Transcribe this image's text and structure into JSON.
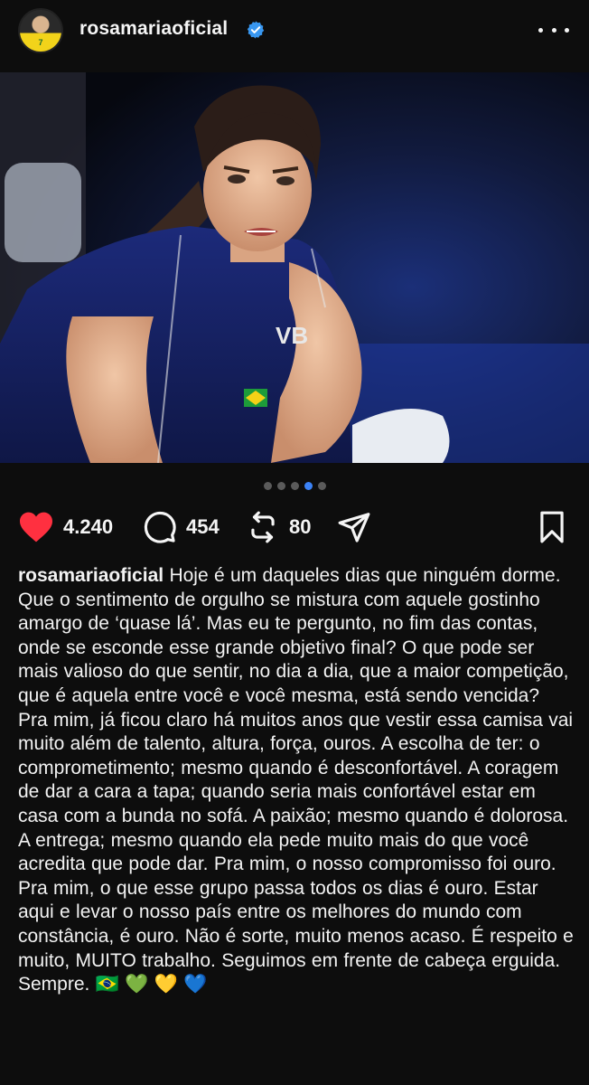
{
  "header": {
    "username": "rosamariaoficial",
    "avatar_jersey_number": "7",
    "verified_icon": "verified-badge-icon",
    "more_icon": "more-horizontal-icon"
  },
  "post": {
    "carousel": {
      "total": 5,
      "active_index": 3
    }
  },
  "actions": {
    "likes": "4.240",
    "comments": "454",
    "reposts": "80",
    "like_icon": "heart-filled-icon",
    "comment_icon": "comment-bubble-icon",
    "repost_icon": "repost-arrows-icon",
    "share_icon": "send-paper-plane-icon",
    "save_icon": "bookmark-icon",
    "like_color": "#ff3040"
  },
  "caption": {
    "username": "rosamariaoficial",
    "text": "Hoje é um daqueles dias que ninguém dorme. Que o sentimento de orgulho se mistura com aquele gostinho amargo de ‘quase lá’. Mas eu te pergunto, no fim das contas, onde se esconde esse grande objetivo final? O que pode ser mais valioso do que sentir, no dia a dia, que a maior competição, que é aquela entre você e você mesma, está sendo vencida? Pra mim, já ficou claro há muitos anos que vestir essa camisa vai muito além de talento, altura, força, ouros. A escolha de ter: o comprometimento; mesmo quando é desconfortável. A coragem de dar a cara a tapa; quando seria mais confortável estar em casa com a bunda no sofá. A paixão; mesmo quando é dolorosa. A entrega; mesmo quando ela pede muito mais do que você acredita que pode dar. Pra mim, o nosso compromisso foi ouro. Pra mim, o que esse grupo passa todos os dias é ouro. Estar aqui e levar o nosso país entre os melhores do mundo com constância, é ouro. Não é sorte, muito menos acaso. É respeito e muito, MUITO trabalho. Seguimos em frente de cabeça erguida. Sempre.",
    "emojis": "🇧🇷 💚 💛 💙"
  }
}
